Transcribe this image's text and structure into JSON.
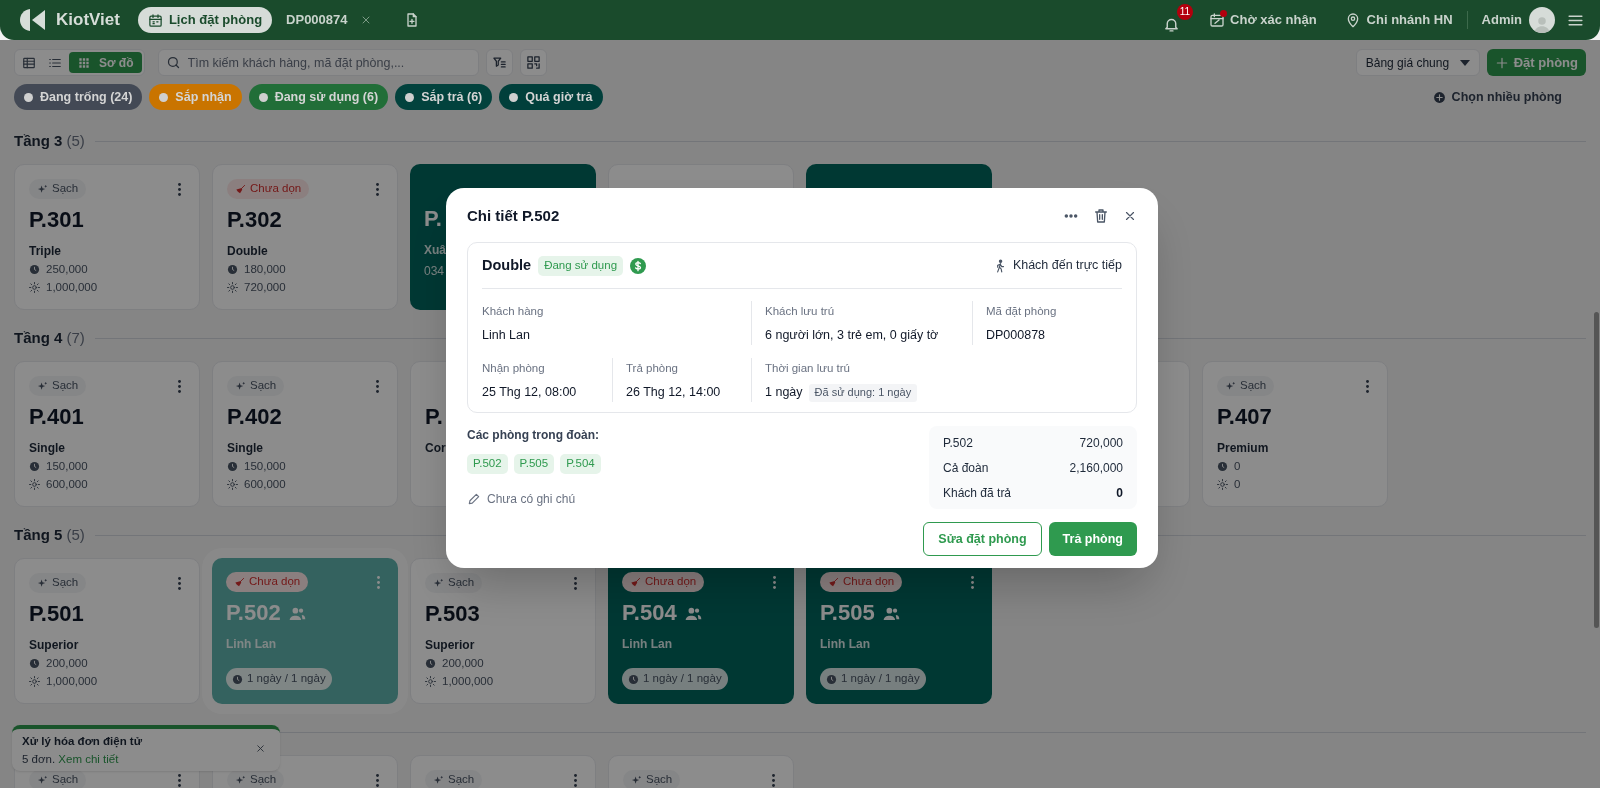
{
  "header": {
    "logo_text": "KiotViet",
    "tabs": [
      {
        "kind": "calendar",
        "label": "Lịch đặt phòng",
        "selected": true
      },
      {
        "kind": "booking",
        "label": "DP000874",
        "selected": false
      }
    ],
    "notification_count": "11",
    "pending_label": "Chờ xác nhận",
    "branch": "Chi nhánh HN",
    "user": "Admin"
  },
  "toolbar": {
    "view_modes": [
      {
        "kind": "table",
        "selected": false
      },
      {
        "kind": "list",
        "selected": false
      },
      {
        "kind": "grid",
        "label": "Sơ đồ",
        "selected": true
      }
    ],
    "search_placeholder": "Tìm kiếm khách hàng, mã đặt phòng,...",
    "price_list": "Bảng giá chung",
    "book_button": "Đặt phòng"
  },
  "status_filters": [
    {
      "label": "Đang trống (24)",
      "color": "#434955"
    },
    {
      "label": "Sắp nhận",
      "color": "#c97400"
    },
    {
      "label": "Đang sử dụng (6)",
      "color": "#216e38"
    },
    {
      "label": "Sắp trả (6)",
      "color": "#02423d"
    },
    {
      "label": "Quá giờ trả",
      "color": "#013f3b"
    }
  ],
  "select_multiple": "Chọn nhiều phòng",
  "floors": [
    {
      "title": "Tầng 3",
      "count": "(5)",
      "rooms": [
        {
          "kind": "vacant",
          "clean": true,
          "badge": "Sạch",
          "number": "P.301",
          "type": "Triple",
          "hourly": "250,000",
          "daily": "1,000,000",
          "selected": false
        },
        {
          "kind": "vacant",
          "clean": false,
          "badge": "Chưa dọn",
          "number": "P.302",
          "type": "Double",
          "hourly": "180,000",
          "daily": "720,000",
          "selected": false
        },
        {
          "kind": "occupied",
          "number": "P.",
          "guest": "Xuâ",
          "phone": "034",
          "selected": false
        },
        {
          "kind": "vacant",
          "selected": false
        },
        {
          "kind": "occupied",
          "selected": false
        }
      ]
    },
    {
      "title": "Tầng 4",
      "count": "(7)",
      "rooms": [
        {
          "kind": "vacant",
          "clean": true,
          "badge": "Sạch",
          "number": "P.401",
          "type": "Single",
          "hourly": "150,000",
          "daily": "600,000",
          "selected": false
        },
        {
          "kind": "vacant",
          "clean": true,
          "badge": "Sạch",
          "number": "P.402",
          "type": "Single",
          "hourly": "150,000",
          "daily": "600,000",
          "selected": false
        },
        {
          "kind": "vacant",
          "number": "P.",
          "type": "Cor",
          "selected": false
        },
        {
          "kind": "covered"
        },
        {
          "kind": "covered"
        },
        {
          "kind": "vacant",
          "selected": false
        },
        {
          "kind": "vacant",
          "clean": true,
          "badge": "Sạch",
          "number": "P.407",
          "type": "Premium",
          "hourly": "0",
          "daily": "0",
          "selected": false
        }
      ]
    },
    {
      "title": "Tầng 5",
      "count": "(5)",
      "rooms": [
        {
          "kind": "vacant",
          "clean": true,
          "badge": "Sạch",
          "number": "P.501",
          "type": "Superior",
          "hourly": "200,000",
          "daily": "1,000,000",
          "selected": false
        },
        {
          "kind": "occupied",
          "clean": false,
          "badge": "Chưa dọn",
          "number": "P.502",
          "group": true,
          "guest": "Linh Lan",
          "duration": "1 ngày / 1 ngày",
          "selected": true
        },
        {
          "kind": "vacant",
          "clean": true,
          "badge": "Sạch",
          "number": "P.503",
          "type": "Superior",
          "hourly": "200,000",
          "daily": "1,000,000",
          "selected": false
        },
        {
          "kind": "occupied",
          "clean": false,
          "badge": "Chưa dọn",
          "number": "P.504",
          "group": true,
          "guest": "Linh Lan",
          "duration": "1 ngày / 1 ngày",
          "selected": false
        },
        {
          "kind": "occupied",
          "clean": false,
          "badge": "Chưa dọn",
          "number": "P.505",
          "group": true,
          "guest": "Linh Lan",
          "duration": "1 ngày / 1 ngày",
          "selected": false
        }
      ]
    },
    {
      "rooms": [
        {
          "kind": "vacant",
          "clean": true,
          "badge": "Sạch",
          "selected": false
        },
        {
          "kind": "vacant",
          "clean": true,
          "badge": "Sạch",
          "selected": false
        },
        {
          "kind": "vacant",
          "clean": true,
          "badge": "Sạch",
          "selected": false
        },
        {
          "kind": "vacant",
          "clean": true,
          "badge": "Sạch",
          "selected": false
        }
      ]
    }
  ],
  "toast": {
    "title": "Xử lý hóa đơn điện tử",
    "text": "5 đơn.",
    "link": "Xem chi tiết"
  },
  "modal": {
    "title": "Chi tiết P.502",
    "room_type": "Double",
    "status": "Đang sử dụng",
    "arrival": "Khách đến trực tiếp",
    "customer": {
      "label": "Khách hàng",
      "value": "Linh Lan"
    },
    "guests": {
      "label": "Khách lưu trú",
      "value": "6 người lớn, 3 trẻ em, 0 giấy tờ"
    },
    "booking_code": {
      "label": "Mã đặt phòng",
      "value": "DP000878"
    },
    "check_in": {
      "label": "Nhận phòng",
      "value": "25 Thg 12, 08:00"
    },
    "check_out": {
      "label": "Trả phòng",
      "value": "26 Thg 12, 14:00"
    },
    "stay": {
      "label": "Thời gian lưu trú",
      "value": "1 ngày",
      "badge": "Đã sử dụng: 1 ngày"
    },
    "group_label": "Các phòng trong đoàn:",
    "group_rooms": [
      "P.502",
      "P.505",
      "P.504"
    ],
    "note_placeholder": "Chưa có ghi chú",
    "totals": [
      {
        "label": "P.502",
        "value": "720,000",
        "emphasis": false
      },
      {
        "label": "Cả đoàn",
        "value": "2,160,000",
        "emphasis": false
      },
      {
        "label": "Khách đã trả",
        "value": "0",
        "emphasis": true
      }
    ],
    "edit_button": "Sửa đặt phòng",
    "checkout_button": "Trả phòng"
  }
}
